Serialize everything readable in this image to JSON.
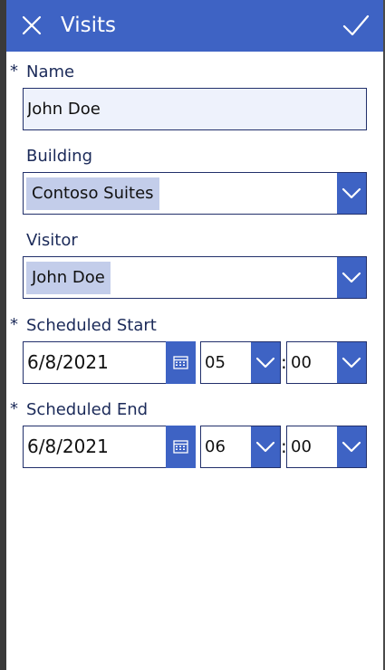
{
  "header": {
    "title": "Visits",
    "close_icon": "close-icon",
    "submit_icon": "checkmark-icon",
    "background": "#3e63c4"
  },
  "form": {
    "required_marker": "*",
    "name": {
      "label": "Name",
      "value": "John Doe",
      "required": true
    },
    "building": {
      "label": "Building",
      "value": "Contoso Suites",
      "required": false
    },
    "visitor": {
      "label": "Visitor",
      "value": "John Doe",
      "required": false
    },
    "scheduled_start": {
      "label": "Scheduled Start",
      "required": true,
      "date": "6/8/2021",
      "hour": "05",
      "minute": "00",
      "separator": ":"
    },
    "scheduled_end": {
      "label": "Scheduled End",
      "required": true,
      "date": "6/8/2021",
      "hour": "06",
      "minute": "00",
      "separator": ":"
    }
  },
  "colors": {
    "accent": "#3e63c4",
    "label_text": "#1b2a59",
    "input_border": "#22306b",
    "chip_background": "#c3cdea",
    "input_background": "#eef2fc"
  }
}
